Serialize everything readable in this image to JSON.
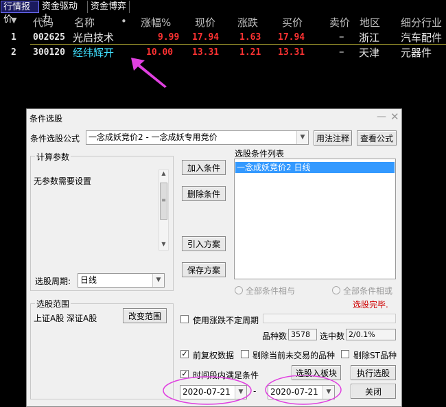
{
  "tabs": [
    "行情报价",
    "资金驱动力",
    "资金博弈"
  ],
  "table": {
    "headers": [
      "代码",
      "名称",
      "•",
      "涨幅%",
      "现价",
      "涨跌",
      "买价",
      "卖价",
      "地区",
      "细分行业"
    ],
    "rows": [
      {
        "idx": "1",
        "code": "002625",
        "name": "光启技术",
        "pct": "9.99",
        "price": "17.94",
        "chg": "1.63",
        "bid": "17.94",
        "ask": "–",
        "region": "浙江",
        "industry": "汽车配件"
      },
      {
        "idx": "2",
        "code": "300120",
        "name": "经纬辉开",
        "pct": "10.00",
        "price": "13.31",
        "chg": "1.21",
        "bid": "13.31",
        "ask": "–",
        "region": "天津",
        "industry": "元器件"
      }
    ]
  },
  "dialog": {
    "title": "条件选股",
    "formula_label": "条件选股公式",
    "formula_value": "一念成妖竞价2 - 一念成妖专用竞价",
    "usage_btn": "用法注释",
    "view_formula_btn": "查看公式",
    "calc_params_label": "计算参数",
    "no_params_text": "无参数需要设置",
    "period_label": "选股周期:",
    "period_value": "日线",
    "add_condition_btn": "加入条件",
    "delete_condition_btn": "删除条件",
    "import_plan_btn": "引入方案",
    "save_plan_btn": "保存方案",
    "condition_list_label": "选股条件列表",
    "conditions": [
      "一念成妖竞价2  日线"
    ],
    "radio_and": "全部条件相与",
    "radio_or": "全部条件相或",
    "status": "选股完毕.",
    "range_label": "选股范围",
    "range_value": "上证A股 深证A股",
    "change_range_btn": "改变范围",
    "use_uncertain_period": "使用涨跌不定周期",
    "count_label": "品种数",
    "count_value": "3578",
    "selected_label": "选中数",
    "selected_value": "2/0.1%",
    "forward_adjust": "前复权数据",
    "exclude_untraded": "剔除当前未交易的品种",
    "exclude_st": "剔除ST品种",
    "time_range": "时间段内满足条件",
    "to_board_btn": "选股入板块",
    "execute_btn": "执行选股",
    "close_btn": "关闭",
    "date_from": "2020-07-21",
    "date_to": "2020-07-21",
    "date_sep": "-"
  },
  "colors": {
    "up": "#ff3232",
    "highlight_name": "#40e0ff",
    "annotation": "#e040e0",
    "selection": "#3399ff"
  }
}
